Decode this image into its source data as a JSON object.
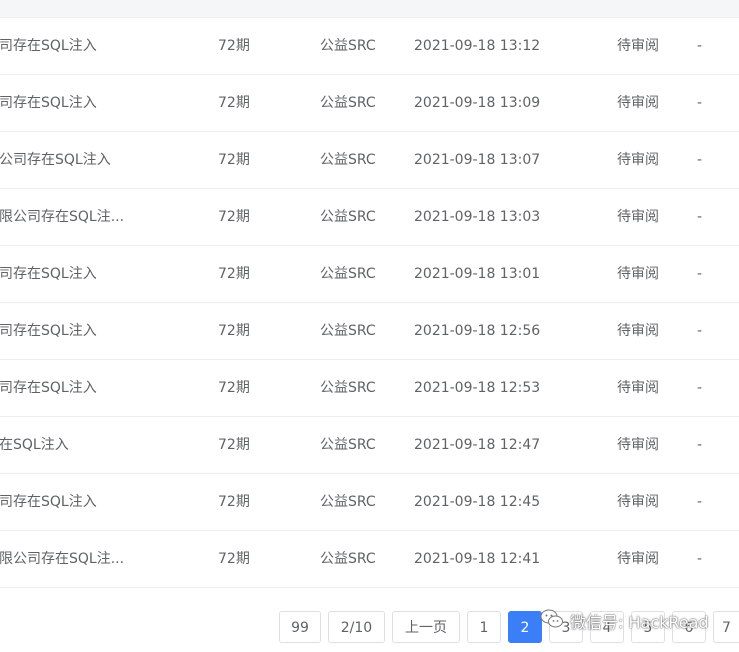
{
  "table": {
    "headers": {
      "title": "",
      "period": "",
      "type": "",
      "time": "",
      "status": "",
      "extra": ""
    },
    "rows": [
      {
        "title": "司存在SQL注入",
        "period": "72期",
        "type": "公益SRC",
        "time": "2021-09-18 13:12",
        "status": "待审阅",
        "extra": "-"
      },
      {
        "title": "司存在SQL注入",
        "period": "72期",
        "type": "公益SRC",
        "time": "2021-09-18 13:09",
        "status": "待审阅",
        "extra": "-"
      },
      {
        "title": "公司存在SQL注入",
        "period": "72期",
        "type": "公益SRC",
        "time": "2021-09-18 13:07",
        "status": "待审阅",
        "extra": "-"
      },
      {
        "title": "限公司存在SQL注...",
        "period": "72期",
        "type": "公益SRC",
        "time": "2021-09-18 13:03",
        "status": "待审阅",
        "extra": "-"
      },
      {
        "title": "司存在SQL注入",
        "period": "72期",
        "type": "公益SRC",
        "time": "2021-09-18 13:01",
        "status": "待审阅",
        "extra": "-"
      },
      {
        "title": "司存在SQL注入",
        "period": "72期",
        "type": "公益SRC",
        "time": "2021-09-18 12:56",
        "status": "待审阅",
        "extra": "-"
      },
      {
        "title": "司存在SQL注入",
        "period": "72期",
        "type": "公益SRC",
        "time": "2021-09-18 12:53",
        "status": "待审阅",
        "extra": "-"
      },
      {
        "title": "在SQL注入",
        "period": "72期",
        "type": "公益SRC",
        "time": "2021-09-18 12:47",
        "status": "待审阅",
        "extra": "-"
      },
      {
        "title": "司存在SQL注入",
        "period": "72期",
        "type": "公益SRC",
        "time": "2021-09-18 12:45",
        "status": "待审阅",
        "extra": "-"
      },
      {
        "title": "限公司存在SQL注...",
        "period": "72期",
        "type": "公益SRC",
        "time": "2021-09-18 12:41",
        "status": "待审阅",
        "extra": "-"
      }
    ]
  },
  "pagination": {
    "total_pages": "99",
    "page_indicator": "2/10",
    "prev_label": "上一页",
    "pages": [
      "1",
      "2",
      "3",
      "4",
      "5",
      "6",
      "7"
    ],
    "active_page": "2"
  },
  "watermark": {
    "text": "微信号: HackRead",
    "icon": "wechat-icon"
  },
  "colors": {
    "accent": "#3a7ff7",
    "header_bg": "#f5f6f8",
    "border": "#ebeef5",
    "text": "#606266"
  }
}
